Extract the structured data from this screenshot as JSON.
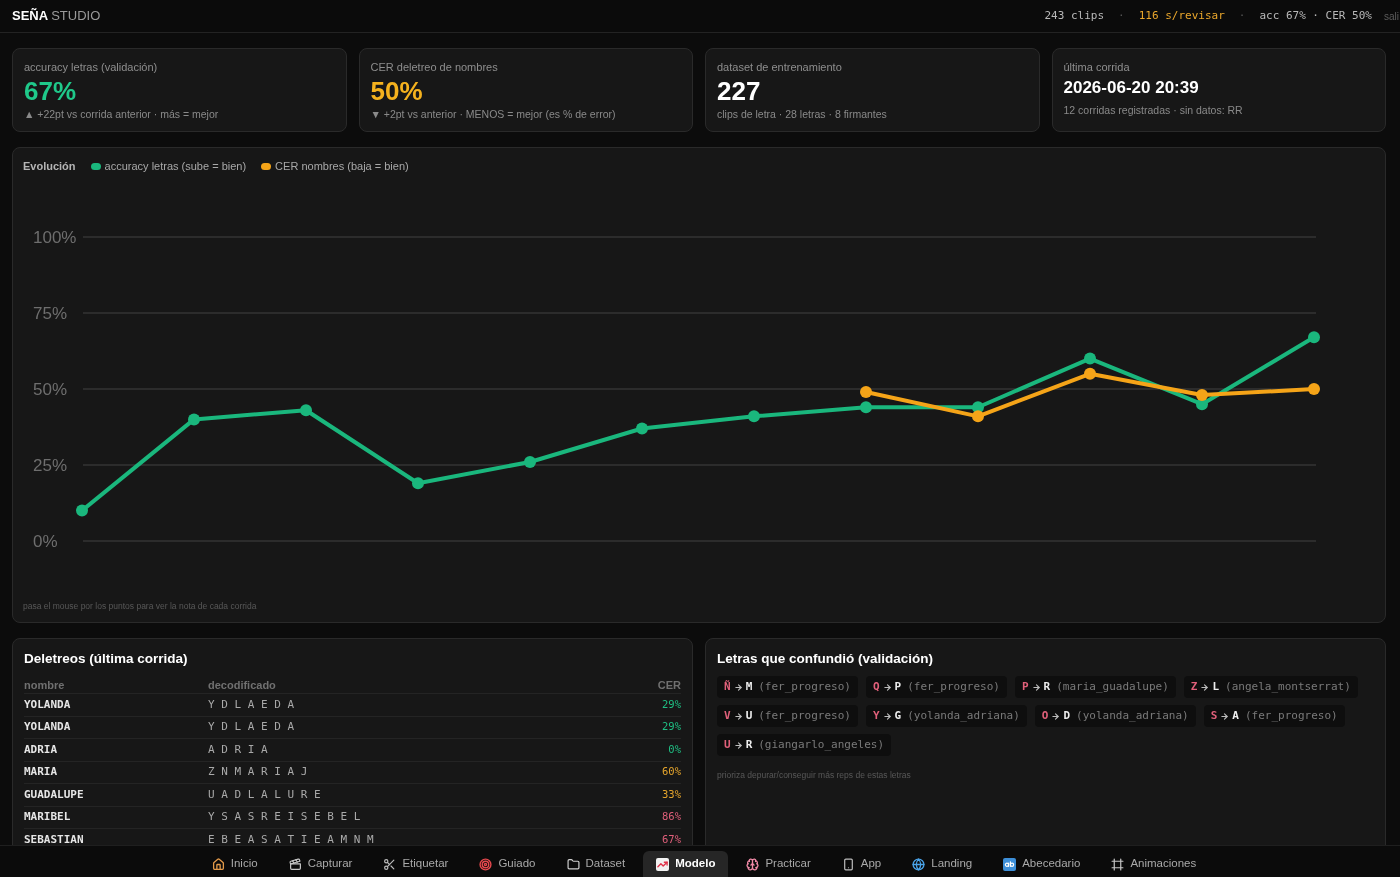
{
  "header": {
    "brand": "SEÑA",
    "brand_suffix": "STUDIO",
    "status": [
      {
        "kind": "stat",
        "text": "243 clips"
      },
      {
        "kind": "sep",
        "text": "·"
      },
      {
        "kind": "alert",
        "text": "116 s/revisar"
      },
      {
        "kind": "sep",
        "text": "·"
      },
      {
        "kind": "stat",
        "text": "acc 67% · CER 50%"
      }
    ],
    "logout": "sali"
  },
  "stat_cards": [
    {
      "kind": "metric",
      "label": "accuracy letras (validación)",
      "value": "67%",
      "color": "#1fc98a",
      "note": "▲ +22pt vs corrida anterior · más = mejor"
    },
    {
      "kind": "metric",
      "label": "CER deletreo de nombres",
      "value": "50%",
      "color": "#f5b21e",
      "note": "▼ +2pt vs anterior · MENOS = mejor (es % de error)"
    },
    {
      "kind": "metric",
      "label": "dataset de entrenamiento",
      "value": "227",
      "color": "#ffffff",
      "note": "clips de letra · 28 letras · 8 firmantes"
    },
    {
      "kind": "timestamp",
      "label": "última corrida",
      "value": "2026-06-20 20:39",
      "color": "#ffffff",
      "note": "12 corridas registradas · sin datos: RR"
    }
  ],
  "chart": {
    "hint": "pasa el mouse por los puntos para ver la nota de cada corrida",
    "chart_data": {
      "type": "line",
      "title": "Evolución",
      "grid": true,
      "ylim": [
        0,
        100
      ],
      "yticks": [
        {
          "value": 100,
          "label": "100%"
        },
        {
          "value": 75,
          "label": "75%"
        },
        {
          "value": 50,
          "label": "50%"
        },
        {
          "value": 25,
          "label": "25%"
        },
        {
          "value": 0,
          "label": "0%"
        }
      ],
      "series": [
        {
          "name": "accuracy letras (sube = bien)",
          "color": "#1ab77d",
          "marker": "circle",
          "values": [
            10,
            40,
            43,
            19,
            26,
            37,
            41,
            44,
            44,
            60,
            45,
            67
          ]
        },
        {
          "name": "CER nombres (baja = bien)",
          "color": "#f5a418",
          "marker": "circle",
          "values": [
            null,
            null,
            null,
            null,
            null,
            null,
            null,
            49,
            41,
            55,
            48,
            50
          ]
        }
      ]
    }
  },
  "spellings": {
    "title": "Deletreos (última corrida)",
    "columns": [
      "nombre",
      "decodificado",
      "CER"
    ],
    "rows": [
      {
        "name": "YOLANDA",
        "decoded": "Y D L A E D A",
        "cer": "29%",
        "color": "#1fbf83"
      },
      {
        "name": "YOLANDA",
        "decoded": "Y D L A E D A",
        "cer": "29%",
        "color": "#1fbf83"
      },
      {
        "name": "ADRIA",
        "decoded": "A D R I A",
        "cer": "0%",
        "color": "#1fbf83"
      },
      {
        "name": "MARIA",
        "decoded": "Z N M A R I A J",
        "cer": "60%",
        "color": "#e5a52c"
      },
      {
        "name": "GUADALUPE",
        "decoded": "U A D L A L U R E",
        "cer": "33%",
        "color": "#e5a52c"
      },
      {
        "name": "MARIBEL",
        "decoded": "Y S A S R E I S E B E L",
        "cer": "86%",
        "color": "#df5f7a"
      },
      {
        "name": "SEBASTIAN",
        "decoded": "E B E A S A T I E A M N M",
        "cer": "67%",
        "color": "#df5f7a"
      }
    ]
  },
  "confusions": {
    "title": "Letras que confundió (validación)",
    "items": [
      {
        "from": "Ñ",
        "to": "M",
        "source": "(fer_progreso)"
      },
      {
        "from": "Q",
        "to": "P",
        "source": "(fer_progreso)"
      },
      {
        "from": "P",
        "to": "R",
        "source": "(maria_guadalupe)"
      },
      {
        "from": "Z",
        "to": "L",
        "source": "(angela_montserrat)"
      },
      {
        "from": "V",
        "to": "U",
        "source": "(fer_progreso)"
      },
      {
        "from": "Y",
        "to": "G",
        "source": "(yolanda_adriana)"
      },
      {
        "from": "O",
        "to": "D",
        "source": "(yolanda_adriana)"
      },
      {
        "from": "S",
        "to": "A",
        "source": "(fer_progreso)"
      },
      {
        "from": "U",
        "to": "R",
        "source": "(giangarlo_angeles)"
      }
    ],
    "note": "prioriza depurar/conseguir más reps de estas letras"
  },
  "nav": [
    {
      "label": "Inicio",
      "selected": false
    },
    {
      "label": "Capturar",
      "selected": false
    },
    {
      "label": "Etiquetar",
      "selected": false
    },
    {
      "label": "Guiado",
      "selected": false
    },
    {
      "label": "Dataset",
      "selected": false
    },
    {
      "label": "Modelo",
      "selected": true
    },
    {
      "label": "Practicar",
      "selected": false
    },
    {
      "label": "App",
      "selected": false
    },
    {
      "label": "Landing",
      "selected": false
    },
    {
      "label": "Abecedario",
      "selected": false
    },
    {
      "label": "Animaciones",
      "selected": false
    }
  ]
}
